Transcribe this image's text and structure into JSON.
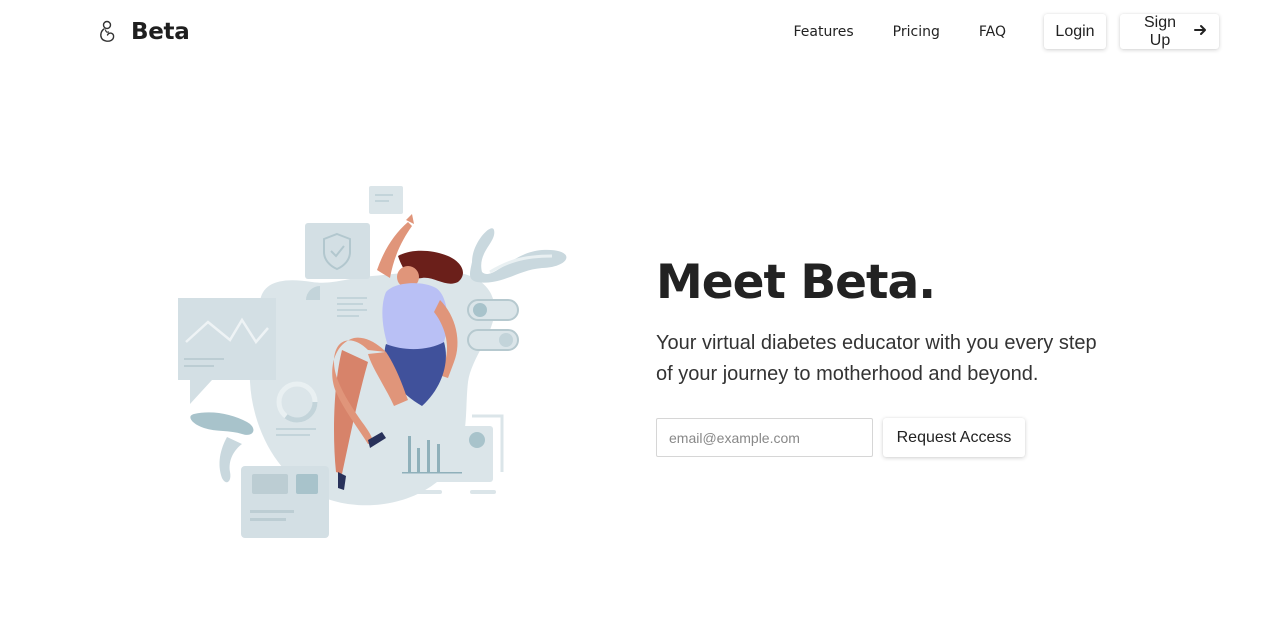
{
  "brand": {
    "name": "Beta",
    "icon": "pregnant-woman-icon"
  },
  "nav": {
    "items": [
      {
        "label": "Features"
      },
      {
        "label": "Pricing"
      },
      {
        "label": "FAQ"
      }
    ],
    "login_label": "Login",
    "signup_label": "Sign Up",
    "signup_icon": "arrow-right-icon"
  },
  "hero": {
    "title": "Meet Beta.",
    "subtitle": "Your virtual diabetes educator with you every step of your journey to motherhood and beyond.",
    "email_placeholder": "email@example.com",
    "email_value": "",
    "request_label": "Request Access"
  },
  "illustration": {
    "name": "woman-jumping-health-dashboard-illustration"
  },
  "colors": {
    "text": "#222222",
    "background": "#ffffff",
    "illustration_light": "#d9e4e8",
    "illustration_mid": "#c3d4da",
    "illustration_accent": "#8fb0ba",
    "skin": "#e0957a",
    "hair": "#6b1f1a",
    "shirt": "#b9c0f5",
    "shorts": "#40519b"
  }
}
